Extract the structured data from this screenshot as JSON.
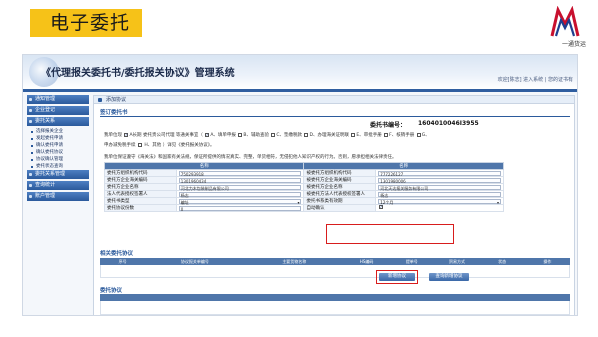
{
  "slide": {
    "title": "电子委托",
    "brand_name": "一通货运"
  },
  "header": {
    "system_title": "《代理报关委托书/委托报关协议》管理系统",
    "user_links": "欢迎[陈志] 进入系统 | 您的证书有"
  },
  "sidebar": {
    "groups": [
      {
        "label": "通知管理",
        "items": []
      },
      {
        "label": "企业登记",
        "items": []
      },
      {
        "label": "委托关系",
        "items": [
          "选择报关企业",
          "发起委托申请",
          "确认委托申请",
          "确认委托协议",
          "协议确认管理",
          "委托状态查询"
        ]
      },
      {
        "label": "委托关系管理",
        "items": []
      },
      {
        "label": "查询统计",
        "items": []
      },
      {
        "label": "账户管理",
        "items": []
      }
    ]
  },
  "main": {
    "crumb": "添加协议",
    "section_title": "签订委托书",
    "contract_label": "委托书编号：",
    "contract_no": "1604010046I3955",
    "para1_prefix": "我单位现",
    "para1_a": "A长期",
    "para1_b": "委托贵公司代理 等通关事宜（",
    "para1_options": [
      "A、填单申报",
      "B、辅助查验",
      "C、垫缴税款",
      "D、办理海关证明联",
      "E、审批手册",
      "F、核销手册",
      "G、"
    ],
    "para2": "申办减免税手续",
    "para2_tail": "H、其他 ）详见《委托报关协议》。",
    "para3": "我单位保证遵守《海关法》和国家有关法规，保证所提供的情况真实、完整，单货相符，无侵犯他人知识产权的行为。否则，愿承担相关法律责任。",
    "form": {
      "headers": [
        "名称",
        "名称"
      ],
      "rows": [
        {
          "left_label": "委托方组织机构代码",
          "left_value": "750293918",
          "right_label": "被委托方组织机构代码",
          "right_value": "777226127"
        },
        {
          "left_label": "委托方企业海关编码",
          "left_value": "1301960434",
          "right_label": "被委托方企业海关编码",
          "right_value": "1301980006"
        },
        {
          "left_label": "委托方企业名称",
          "left_value": "河北力木包装制品有限公司",
          "right_label": "被委托方企业名称",
          "right_value": "河北天达报关服务有限公司"
        },
        {
          "left_label": "法人代表授权签署人",
          "left_value": "杨志",
          "right_label": "被委托方法人代表授权签署人",
          "right_value": "杨志"
        },
        {
          "left_label": "委托书类型",
          "left_value": "编址",
          "right_label": "委托书系类有效期",
          "right_value": "12个月"
        },
        {
          "left_label": "委托协议份数",
          "left_value": "0",
          "right_label": "自动确认",
          "right_value": ""
        }
      ]
    },
    "related_title": "相关委托协议",
    "related_headers": [
      "序号",
      "协议报关单编号",
      "主要货物名称",
      "HS编码",
      "提单号",
      "贸易方式",
      "状态",
      "操作"
    ],
    "btn_new": "新增协议",
    "btn_query": "查询新增协议",
    "delegate_title": "委托协议"
  },
  "colors": {
    "slide_title_bg": "#f6c218",
    "nav_header": "#2b5a9c",
    "table_header": "#4f76aa",
    "highlight": "#d81d1d"
  },
  "icons": {
    "brand": "brand-logo-icon",
    "crumb": "page-icon",
    "select": "chevron-down-icon",
    "checked": "checkmark-icon"
  }
}
